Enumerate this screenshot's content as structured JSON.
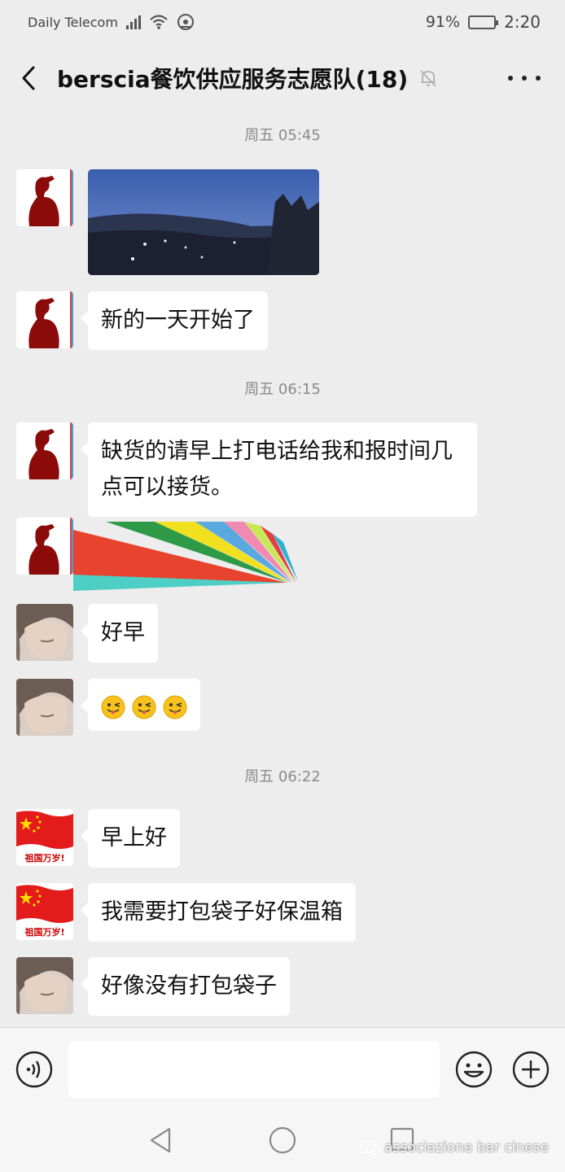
{
  "status_bar": {
    "carrier": "Daily Telecom",
    "battery_pct": "91%",
    "battery_level": 0.91,
    "time": "2:20"
  },
  "header": {
    "title": "berscia餐饮供应服务志愿队(18)"
  },
  "messages": {
    "ts1": "周五 05:45",
    "m2": "新的一天开始了",
    "ts2": "周五 06:15",
    "m3": "缺货的请早上打电话给我和报时间几点可以接货。",
    "m5": "好早",
    "ts3": "周五 06:22",
    "m7": "早上好",
    "m8": "我需要打包袋子好保温箱",
    "m9": "好像没有打包袋子"
  },
  "avatar_flag_text": "祖国万岁!",
  "watermark": "associazione bar cinese",
  "colors": {
    "background": "#ededed",
    "bubble": "#ffffff",
    "input_bar": "#f6f6f6"
  }
}
